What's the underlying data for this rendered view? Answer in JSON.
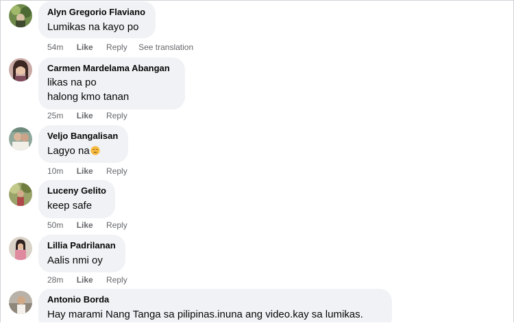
{
  "comments": [
    {
      "author": "Alyn Gregorio Flaviano",
      "lines": [
        "Lumikas na kayo po"
      ],
      "time": "54m",
      "like": "Like",
      "reply": "Reply",
      "translate": "See translation"
    },
    {
      "author": "Carmen Mardelama Abangan",
      "lines": [
        "likas na po",
        "halong kmo tanan"
      ],
      "time": "25m",
      "like": "Like",
      "reply": "Reply"
    },
    {
      "author": "Veljo Bangalisan",
      "lines": [
        "Lagyo na"
      ],
      "emoji": "disappointed-face-emoji",
      "time": "10m",
      "like": "Like",
      "reply": "Reply"
    },
    {
      "author": "Luceny Gelito",
      "lines": [
        "keep safe"
      ],
      "time": "50m",
      "like": "Like",
      "reply": "Reply"
    },
    {
      "author": "Lillia Padrilanan",
      "lines": [
        "Aalis nmi oy"
      ],
      "time": "28m",
      "like": "Like",
      "reply": "Reply"
    },
    {
      "author": "Antonio Borda",
      "lines": [
        "Hay marami Nang Tanga sa pilipinas.inuna ang video.kay sa lumikas."
      ]
    }
  ],
  "colors": {
    "bubble": "#f0f2f5",
    "meta_text": "#65676b",
    "text": "#050505"
  }
}
